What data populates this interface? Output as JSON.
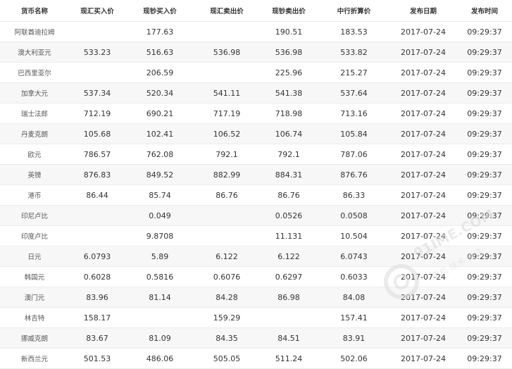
{
  "table": {
    "headers": [
      "货币名称",
      "现汇买入价",
      "现钞买入价",
      "现汇卖出价",
      "现钞卖出价",
      "中行折算价",
      "发布日期",
      "发布时间"
    ],
    "rows": [
      [
        "阿联酋迪拉姆",
        "",
        "177.63",
        "",
        "190.51",
        "183.53",
        "2017-07-24",
        "09:29:37"
      ],
      [
        "澳大利亚元",
        "533.23",
        "516.63",
        "536.98",
        "536.98",
        "533.82",
        "2017-07-24",
        "09:29:37"
      ],
      [
        "巴西里亚尔",
        "",
        "206.59",
        "",
        "225.96",
        "215.27",
        "2017-07-24",
        "09:29:37"
      ],
      [
        "加拿大元",
        "537.34",
        "520.34",
        "541.11",
        "541.38",
        "537.64",
        "2017-07-24",
        "09:29:37"
      ],
      [
        "瑞士法郎",
        "712.19",
        "690.21",
        "717.19",
        "718.98",
        "713.16",
        "2017-07-24",
        "09:29:37"
      ],
      [
        "丹麦克朗",
        "105.68",
        "102.41",
        "106.52",
        "106.74",
        "105.84",
        "2017-07-24",
        "09:29:37"
      ],
      [
        "欧元",
        "786.57",
        "762.08",
        "792.1",
        "792.1",
        "787.06",
        "2017-07-24",
        "09:29:37"
      ],
      [
        "英镑",
        "876.83",
        "849.52",
        "882.99",
        "884.31",
        "876.76",
        "2017-07-24",
        "09:29:37"
      ],
      [
        "港币",
        "86.44",
        "85.74",
        "86.76",
        "86.76",
        "86.33",
        "2017-07-24",
        "09:29:37"
      ],
      [
        "印尼卢比",
        "",
        "0.049",
        "",
        "0.0526",
        "0.0508",
        "2017-07-24",
        "09:29:37"
      ],
      [
        "印度卢比",
        "",
        "9.8708",
        "",
        "11.131",
        "10.504",
        "2017-07-24",
        "09:29:37"
      ],
      [
        "日元",
        "6.0793",
        "5.89",
        "6.122",
        "6.122",
        "6.0743",
        "2017-07-24",
        "09:29:37"
      ],
      [
        "韩国元",
        "0.6028",
        "0.5816",
        "0.6076",
        "0.6297",
        "0.6033",
        "2017-07-24",
        "09:29:37"
      ],
      [
        "澳门元",
        "83.96",
        "81.14",
        "84.28",
        "86.98",
        "84.08",
        "2017-07-24",
        "09:29:37"
      ],
      [
        "林吉特",
        "158.17",
        "",
        "159.29",
        "",
        "157.41",
        "2017-07-24",
        "09:29:37"
      ],
      [
        "挪威克朗",
        "83.67",
        "81.09",
        "84.35",
        "84.51",
        "83.91",
        "2017-07-24",
        "09:29:37"
      ],
      [
        "新西兰元",
        "501.53",
        "486.06",
        "505.05",
        "511.24",
        "502.06",
        "2017-07-24",
        "09:29:37"
      ]
    ]
  },
  "watermark": {
    "text": "91IME.COM",
    "sub": "手机·技术·资讯"
  },
  "colors": {
    "text": "#333333",
    "row_alt": "#f7f7f7",
    "divider": "#ececec",
    "watermark": "#d8d8d8"
  }
}
